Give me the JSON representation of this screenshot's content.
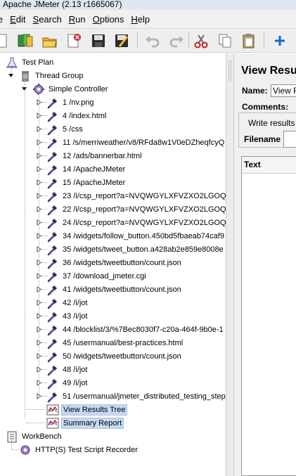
{
  "window": {
    "title": "Apache JMeter (2.13 r1665067)"
  },
  "menu": [
    "le",
    "Edit",
    "Search",
    "Run",
    "Options",
    "Help"
  ],
  "toolbar": [
    {
      "name": "new-icon"
    },
    {
      "name": "templates-icon"
    },
    {
      "name": "open-icon"
    },
    {
      "name": "close-file-icon"
    },
    {
      "name": "save-icon"
    },
    {
      "name": "save-as-icon"
    },
    {
      "name": "undo-icon"
    },
    {
      "name": "redo-icon"
    },
    {
      "name": "cut-icon"
    },
    {
      "name": "copy-icon"
    },
    {
      "name": "paste-icon"
    },
    {
      "name": "expand-icon"
    }
  ],
  "tree": {
    "test_plan": "Test Plan",
    "thread_group": "Thread Group",
    "simple_controller": "Simple Controller",
    "samplers": [
      "1 /nv.png",
      "4 /index.html",
      "5 /css",
      "11 /s/merriweather/v8/RFda8w1V0eDZheqfcyQ",
      "12 /ads/bannerbar.html",
      "14 /ApacheJMeter",
      "15 /ApacheJMeter",
      "23 /i/csp_report?a=NVQWGYLXFVZXO2LGOQ",
      "22 /i/csp_report?a=NVQWGYLXFVZXO2LGOQ",
      "24 /i/csp_report?a=NVQWGYLXFVZXO2LGOQ",
      "34 /widgets/follow_button.450bd5fbaeab74caf9",
      "35 /widgets/tweet_button.a428ab2e859e8008e",
      "36 /widgets/tweetbutton/count.json",
      "37 /download_jmeter.cgi",
      "41 /widgets/tweetbutton/count.json",
      "42 /i/jot",
      "43 /i/jot",
      "44 /blocklist/3/%7Bec8030f7-c20a-464f-9b0e-1",
      "45 /usermanual/best-practices.html",
      "50 /widgets/tweetbutton/count.json",
      "48 /i/jot",
      "49 /i/jot",
      "51 /usermanual/jmeter_distributed_testing_step_"
    ],
    "listeners": [
      "View Results Tree",
      "Summary Report"
    ],
    "workbench": "WorkBench",
    "recorder": "HTTP(S) Test Script Recorder"
  },
  "right_panel": {
    "title": "View Resu",
    "name_label": "Name:",
    "name_value": "View R",
    "comments_label": "Comments:",
    "write_results_label": "Write results",
    "filename_label": "Filename",
    "filename_value": "",
    "table_header": "Text"
  }
}
